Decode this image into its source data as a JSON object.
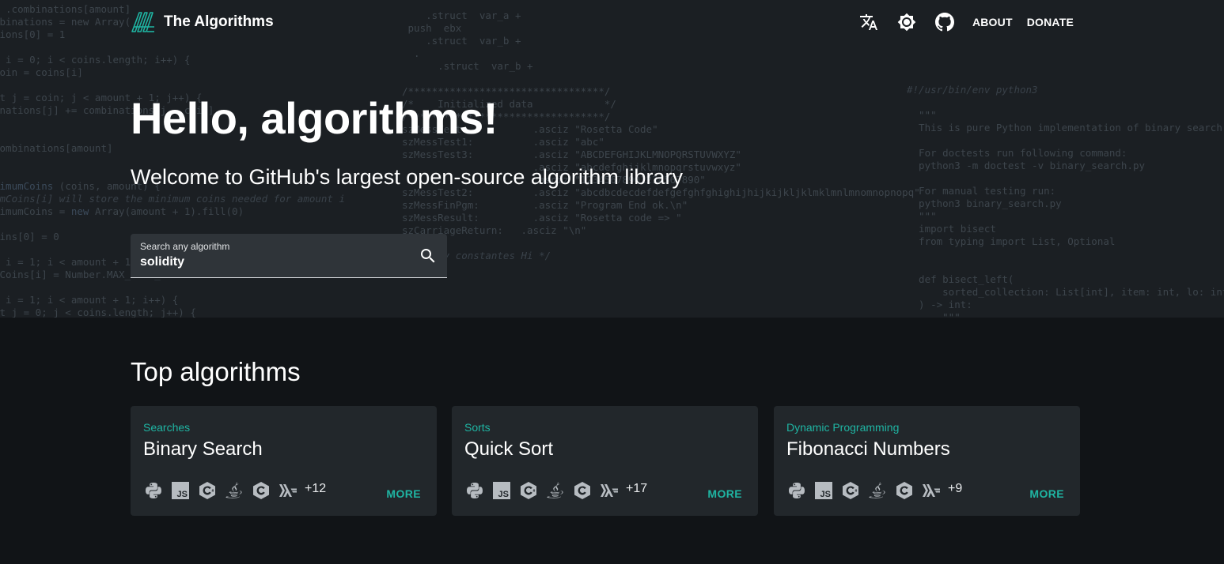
{
  "header": {
    "brand_name": "The Algorithms",
    "icons": [
      "translate-icon",
      "brightness-icon",
      "github-icon"
    ],
    "about_label": "ABOUT",
    "donate_label": "DONATE"
  },
  "hero": {
    "title": "Hello, algorithms!",
    "subtitle": "Welcome to GitHub's largest open-source algorithm library",
    "search": {
      "label": "Search any algorithm",
      "value": "solidity"
    }
  },
  "top_algorithms": {
    "heading": "Top algorithms",
    "more_label": "MORE",
    "cards": [
      {
        "category": "Searches",
        "title": "Binary Search",
        "extra_count": "+12"
      },
      {
        "category": "Sorts",
        "title": "Quick Sort",
        "extra_count": "+17"
      },
      {
        "category": "Dynamic Programming",
        "title": "Fibonacci Numbers",
        "extra_count": "+9"
      }
    ],
    "language_icons": [
      "python-icon",
      "javascript-icon",
      "csharp-icon",
      "java-icon",
      "c-icon",
      "haskell-icon"
    ]
  },
  "colors": {
    "accent": "#1fb5a3",
    "hero_bg": "#1b1f23",
    "page_bg": "#111417",
    "card_bg": "#22272b"
  }
}
